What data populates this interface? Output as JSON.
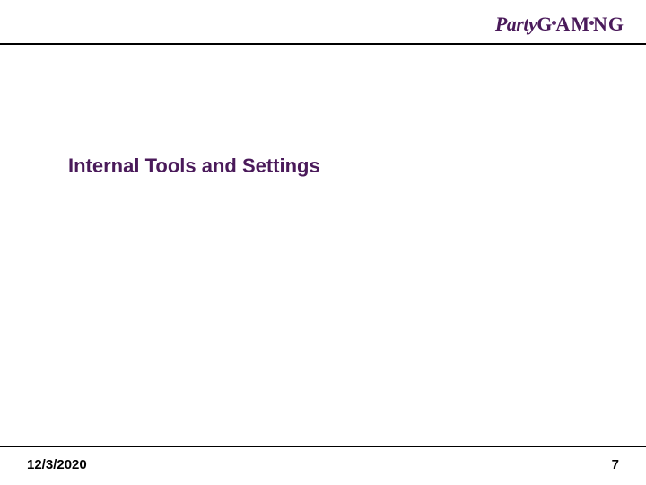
{
  "header": {
    "logo_party": "Party",
    "logo_gaming": "Gaming"
  },
  "main": {
    "title": "Internal Tools and Settings"
  },
  "footer": {
    "date": "12/3/2020",
    "page_number": "7"
  }
}
